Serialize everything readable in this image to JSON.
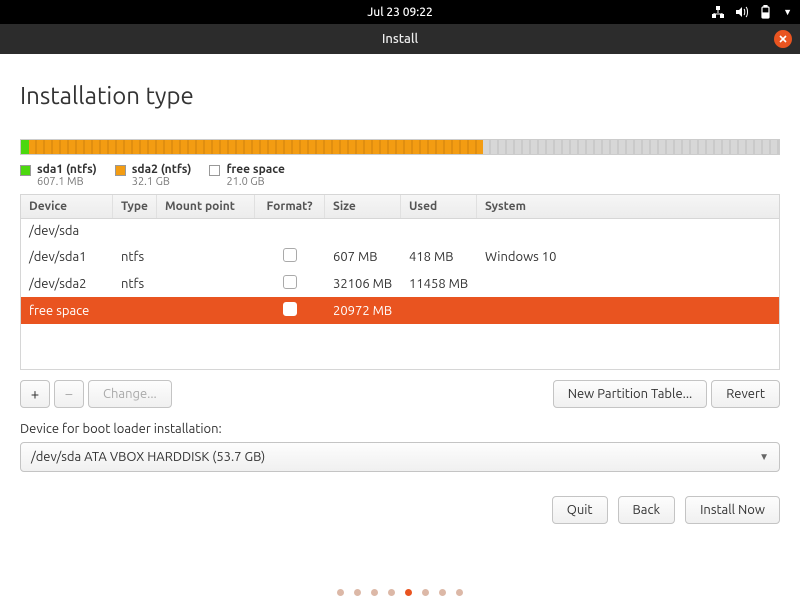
{
  "topbar": {
    "clock": "Jul 23  09:22"
  },
  "window": {
    "title": "Install"
  },
  "page": {
    "heading": "Installation type"
  },
  "legend": [
    {
      "label": "sda1 (ntfs)",
      "sub": "607.1 MB",
      "cls": "g"
    },
    {
      "label": "sda2 (ntfs)",
      "sub": "32.1 GB",
      "cls": "o"
    },
    {
      "label": "free space",
      "sub": "21.0 GB",
      "cls": "w"
    }
  ],
  "columns": {
    "device": "Device",
    "type": "Type",
    "mount": "Mount point",
    "format": "Format?",
    "size": "Size",
    "used": "Used",
    "system": "System"
  },
  "rows": [
    {
      "device": "/dev/sda",
      "type": "",
      "mount": "",
      "format": null,
      "size": "",
      "used": "",
      "system": ""
    },
    {
      "device": " /dev/sda1",
      "type": "ntfs",
      "mount": "",
      "format": false,
      "size": "607 MB",
      "used": "418 MB",
      "system": "Windows 10"
    },
    {
      "device": " /dev/sda2",
      "type": "ntfs",
      "mount": "",
      "format": false,
      "size": "32106 MB",
      "used": "11458 MB",
      "system": ""
    },
    {
      "device": " free space",
      "type": "",
      "mount": "",
      "format": false,
      "size": "20972 MB",
      "used": "",
      "system": "",
      "selected": true
    }
  ],
  "toolbar": {
    "add": "+",
    "remove": "−",
    "change": "Change...",
    "new_table": "New Partition Table...",
    "revert": "Revert"
  },
  "boot": {
    "label": "Device for boot loader installation:",
    "value": "/dev/sda   ATA VBOX HARDDISK (53.7 GB)"
  },
  "footer": {
    "quit": "Quit",
    "back": "Back",
    "install": "Install Now"
  },
  "disk": {
    "seg1_pct": 1.1,
    "seg2_pct": 59.8,
    "seg3_pct": 39.1
  }
}
